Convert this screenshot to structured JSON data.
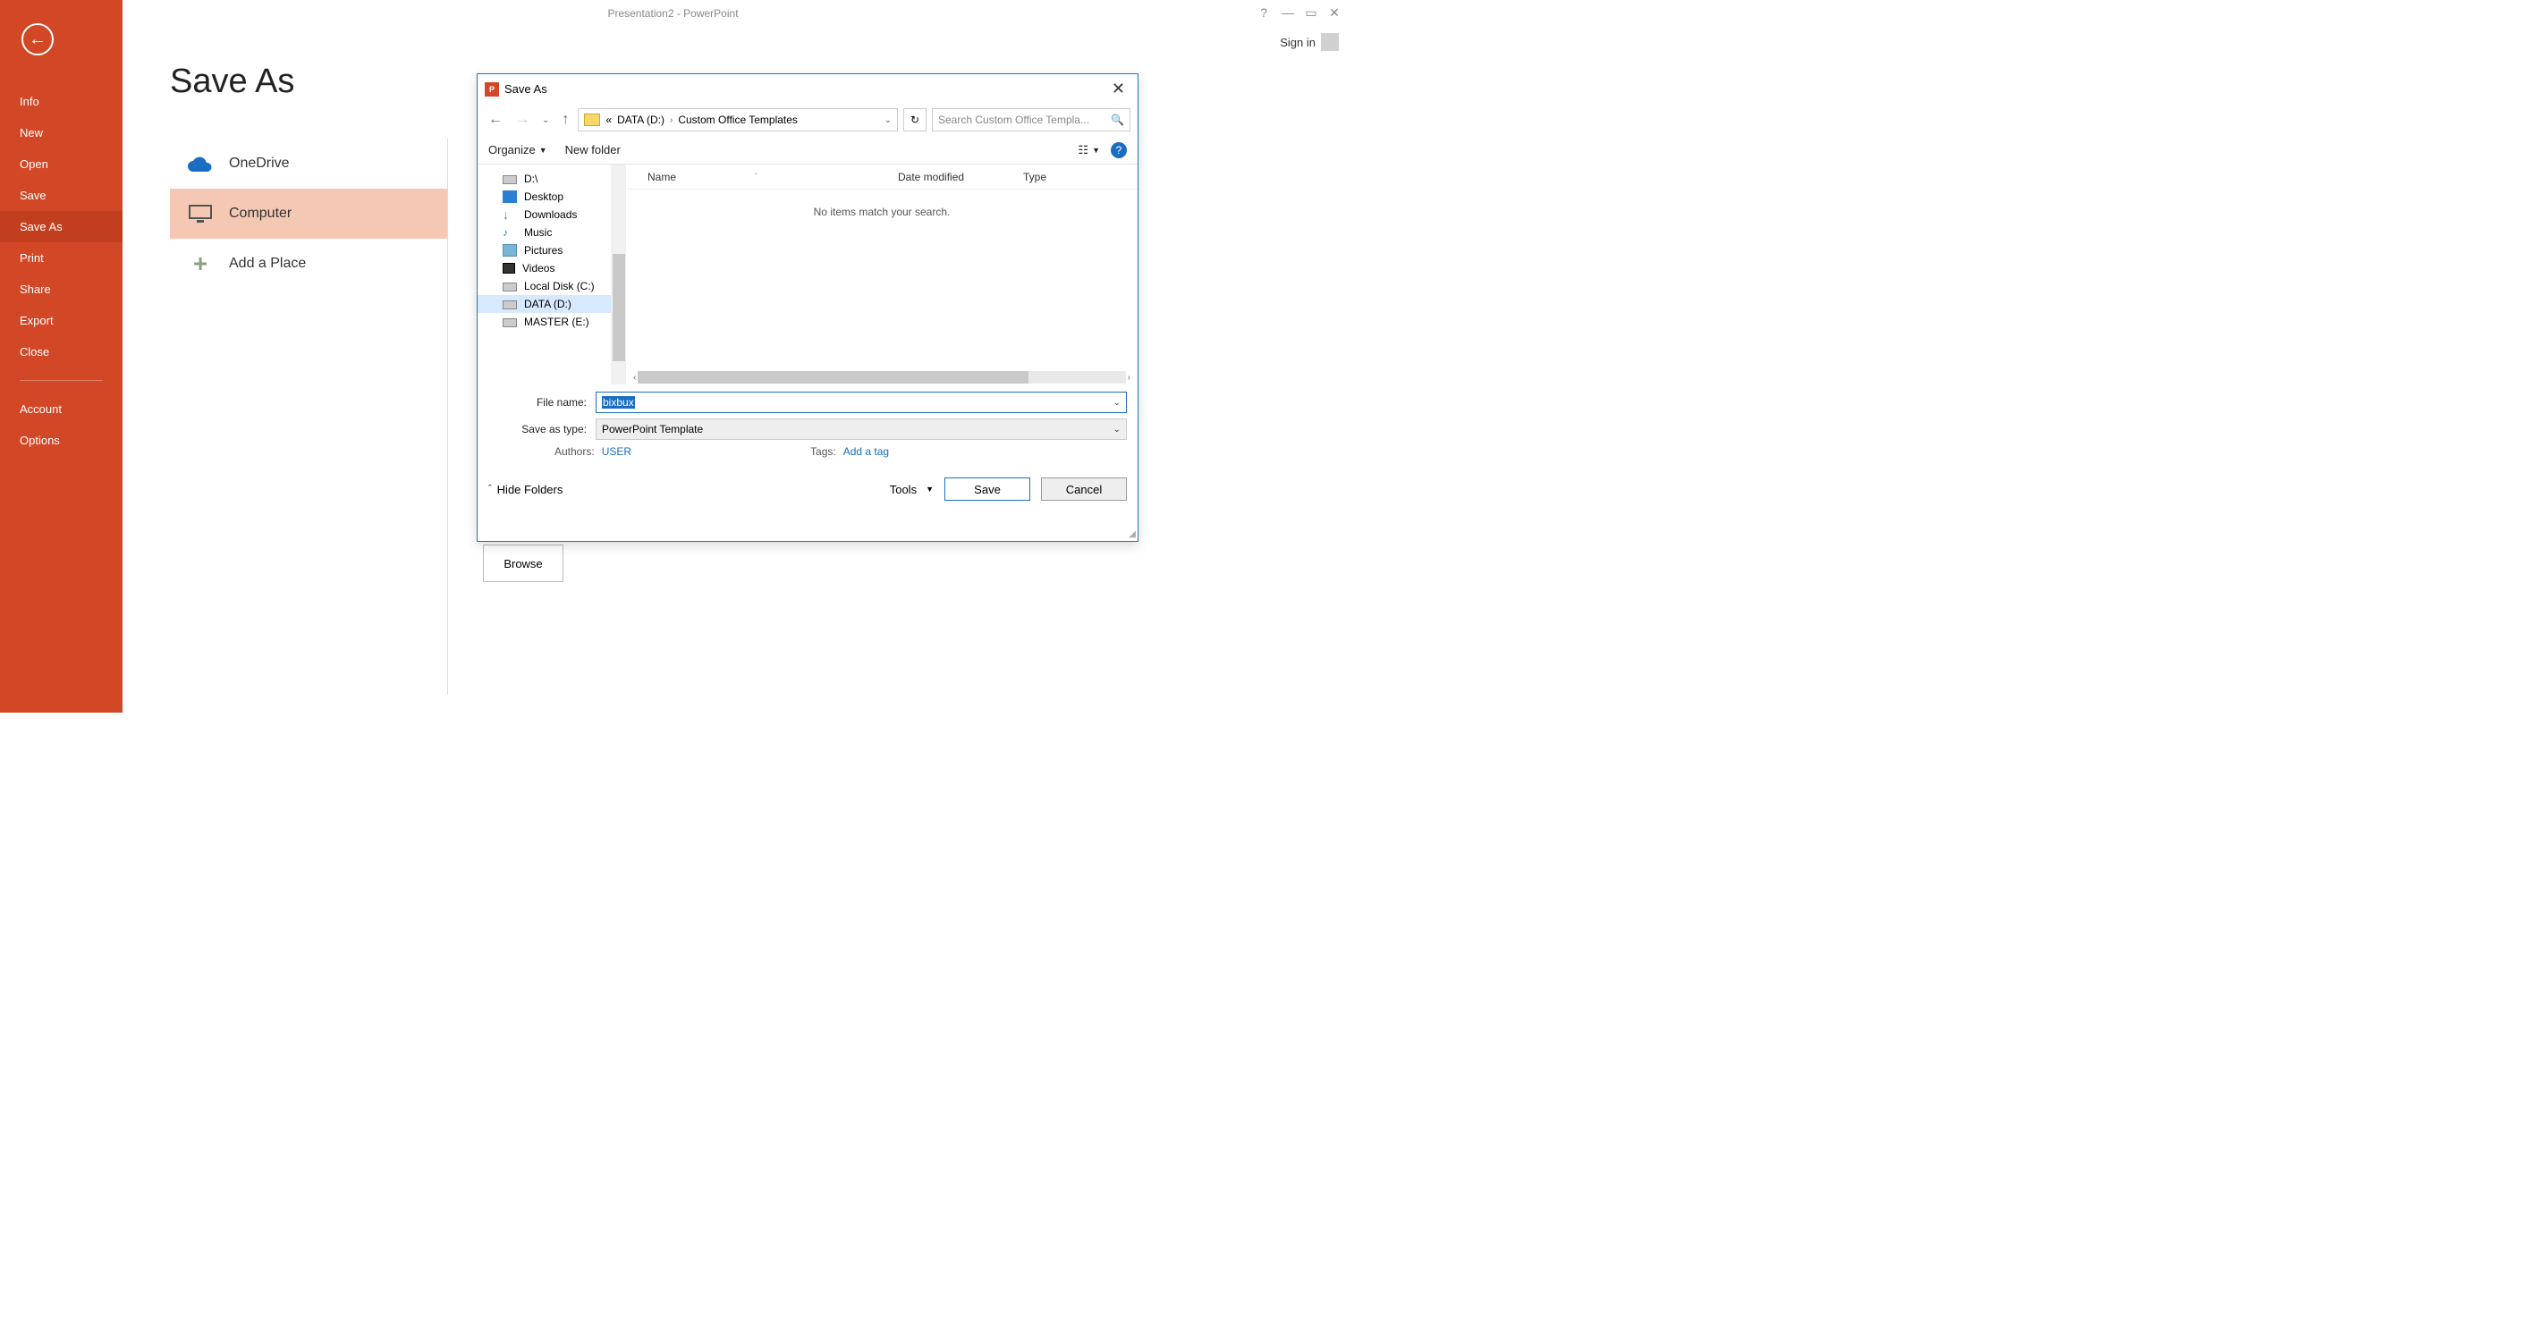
{
  "window": {
    "title": "Presentation2 - PowerPoint",
    "sign_in": "Sign in"
  },
  "sidebar": {
    "items": [
      "Info",
      "New",
      "Open",
      "Save",
      "Save As",
      "Print",
      "Share",
      "Export",
      "Close"
    ],
    "account": "Account",
    "options": "Options",
    "active": "Save As"
  },
  "page": {
    "title": "Save As"
  },
  "locations": {
    "onedrive": "OneDrive",
    "computer": "Computer",
    "add_place": "Add a Place"
  },
  "browse_label": "Browse",
  "dialog": {
    "title": "Save As",
    "breadcrumb": {
      "prefix": "«",
      "seg1": "DATA (D:)",
      "seg2": "Custom Office Templates"
    },
    "search_placeholder": "Search Custom Office Templa...",
    "toolbar": {
      "organize": "Organize",
      "new_folder": "New folder"
    },
    "tree": [
      "D:\\",
      "Desktop",
      "Downloads",
      "Music",
      "Pictures",
      "Videos",
      "Local Disk (C:)",
      "DATA (D:)",
      "MASTER (E:)"
    ],
    "columns": {
      "name": "Name",
      "date": "Date modified",
      "type": "Type"
    },
    "empty": "No items match your search.",
    "file_name_label": "File name:",
    "file_name_value": "bixbux",
    "save_type_label": "Save as type:",
    "save_type_value": "PowerPoint Template",
    "authors_label": "Authors:",
    "authors_value": "USER",
    "tags_label": "Tags:",
    "tags_value": "Add a tag",
    "hide_folders": "Hide Folders",
    "tools": "Tools",
    "save": "Save",
    "cancel": "Cancel"
  }
}
